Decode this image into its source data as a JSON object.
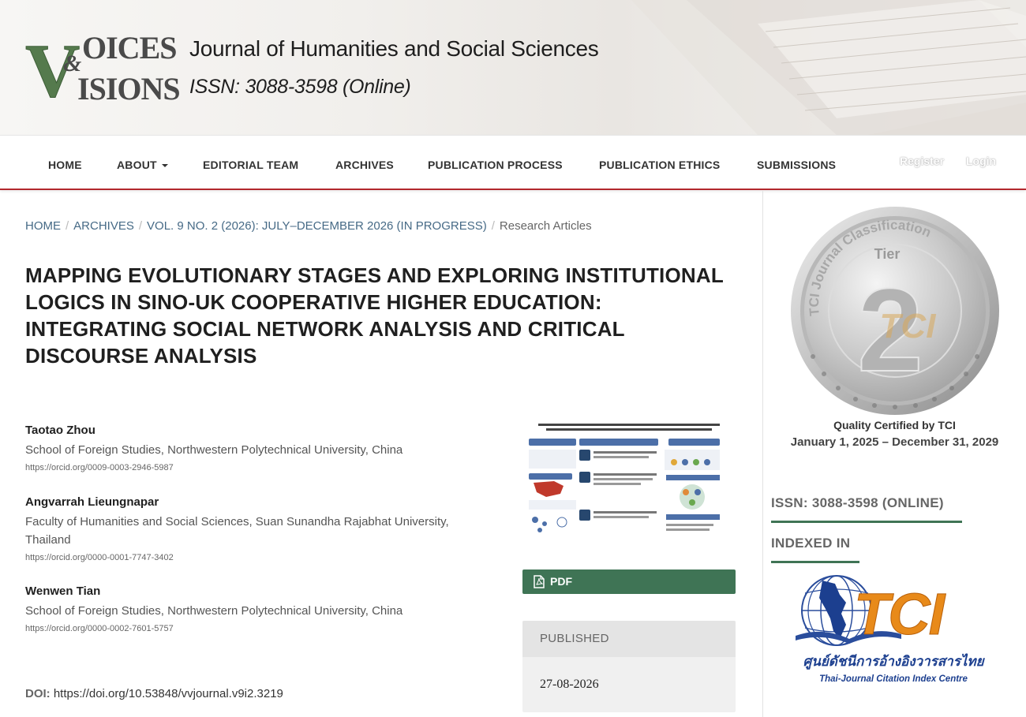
{
  "header": {
    "logo_text": "VOICES & VISIONS",
    "journal_name": "Journal of Humanities and Social Sciences",
    "issn_line": "ISSN: 3088-3598 (Online)"
  },
  "nav": {
    "items": [
      {
        "label": "HOME"
      },
      {
        "label": "ABOUT"
      },
      {
        "label": "EDITORIAL TEAM"
      },
      {
        "label": "ARCHIVES"
      },
      {
        "label": "PUBLICATION PROCESS"
      },
      {
        "label": "PUBLICATION ETHICS"
      },
      {
        "label": "SUBMISSIONS"
      }
    ],
    "register": "Register",
    "login": "Login"
  },
  "breadcrumb": {
    "items": [
      "HOME",
      "ARCHIVES",
      "VOL. 9 NO. 2 (2026): JULY–DECEMBER 2026 (IN PROGRESS)"
    ],
    "current": "Research Articles"
  },
  "article": {
    "title": "MAPPING EVOLUTIONARY STAGES AND EXPLORING INSTITUTIONAL LOGICS IN SINO-UK COOPERATIVE HIGHER EDUCATION: INTEGRATING SOCIAL NETWORK ANALYSIS AND CRITICAL DISCOURSE ANALYSIS",
    "authors": [
      {
        "name": "Taotao Zhou",
        "affiliation": "School of Foreign Studies, Northwestern Polytechnical University, China",
        "orcid": "https://orcid.org/0009-0003-2946-5987"
      },
      {
        "name": "Angvarrah Lieungnapar",
        "affiliation": "Faculty of Humanities and Social Sciences, Suan Sunandha Rajabhat University, Thailand",
        "orcid": "https://orcid.org/0000-0001-7747-3402"
      },
      {
        "name": "Wenwen Tian",
        "affiliation": "School of Foreign Studies, Northwestern Polytechnical University, China",
        "orcid": "https://orcid.org/0000-0002-7601-5757"
      }
    ],
    "doi_label": "DOI:",
    "doi_value": "https://doi.org/10.53848/vvjournal.v9i2.3219",
    "pdf_label": "PDF",
    "published_label": "PUBLISHED",
    "published_date": "27-08-2026"
  },
  "sidebar": {
    "coin_tier": "Tier",
    "coin_number": "2",
    "coin_arc": "TCI Journal Classification",
    "coin_brand": "TCI",
    "quality_line1": "Quality Certified by TCI",
    "quality_line2": "January 1, 2025 – December 31, 2029",
    "issn": "ISSN: 3088-3598 (ONLINE)",
    "indexed_in": "INDEXED IN",
    "tci_brand": "TCI",
    "tci_thai": "ศูนย์ดัชนีการอ้างอิงวารสารไทย",
    "tci_english": "Thai-Journal Citation Index Centre"
  },
  "colors": {
    "accent_green": "#3f7455",
    "nav_border_red": "#b2282c",
    "link_blue": "#466a86",
    "tci_orange": "#e88a1a",
    "tci_blue": "#1c3f8f"
  }
}
